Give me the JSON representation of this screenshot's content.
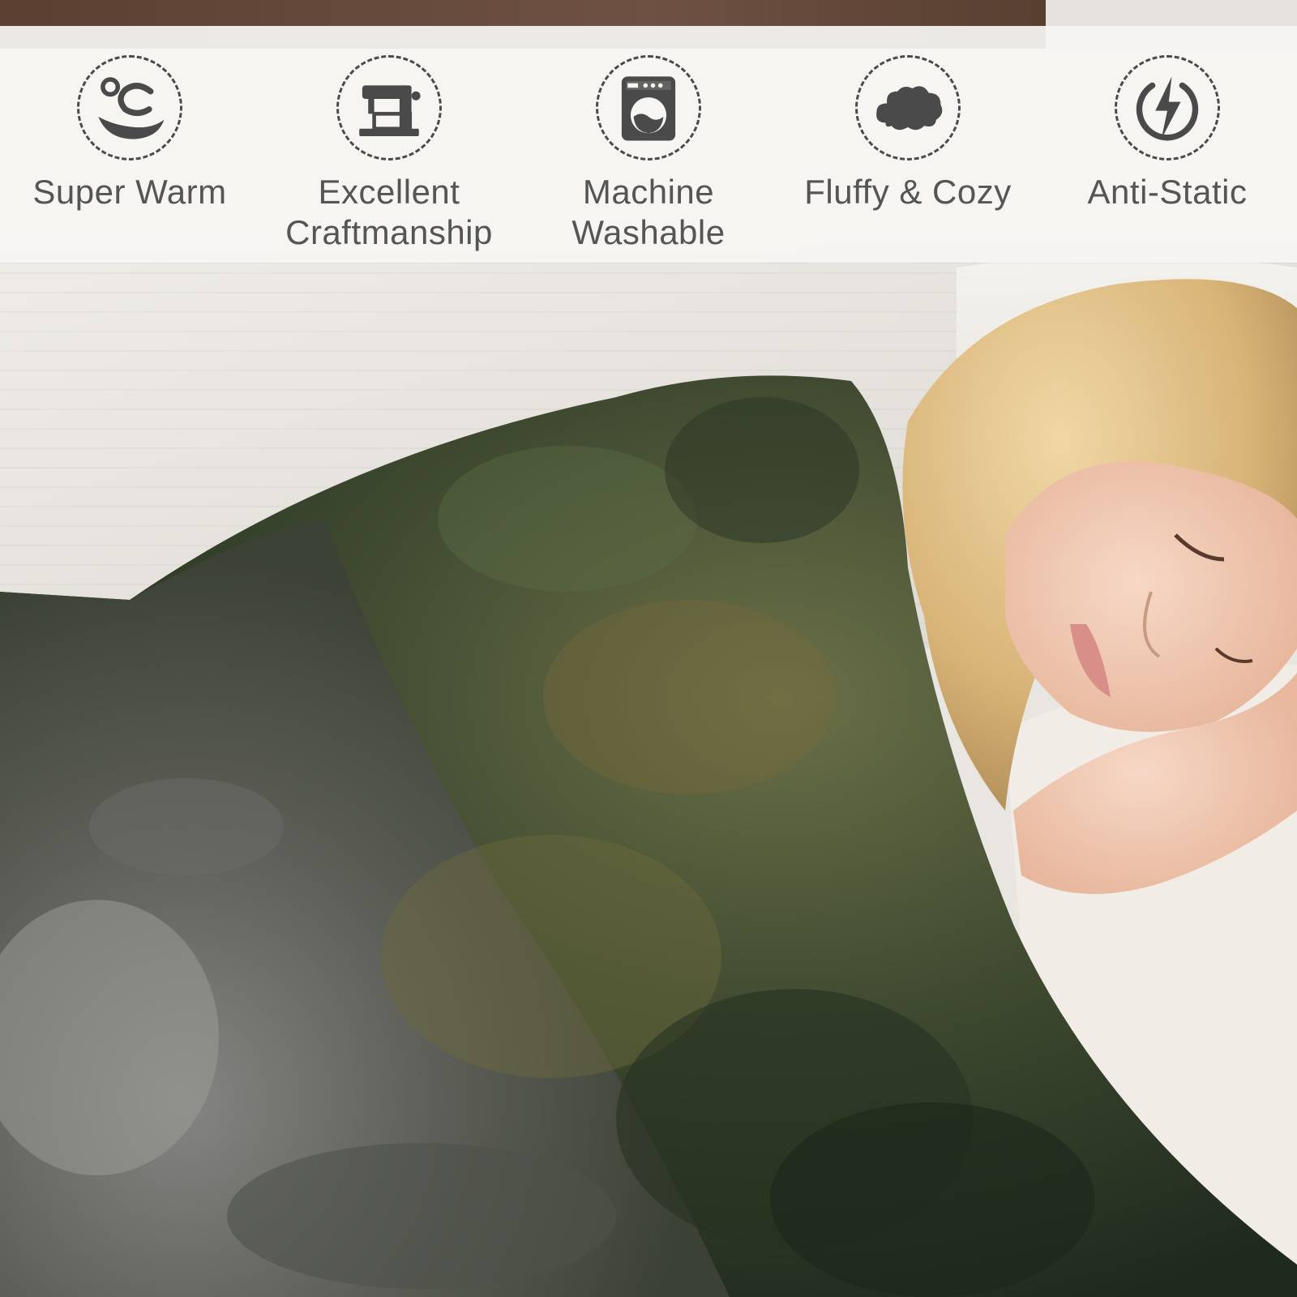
{
  "features": [
    {
      "icon": "warm-temperature-icon",
      "label_lines": [
        "Super Warm"
      ]
    },
    {
      "icon": "sewing-machine-icon",
      "label_lines": [
        "Excellent",
        "Craftmanship"
      ]
    },
    {
      "icon": "washing-machine-icon",
      "label_lines": [
        "Machine",
        "Washable"
      ]
    },
    {
      "icon": "cloud-icon",
      "label_lines": [
        "Fluffy & Cozy"
      ]
    },
    {
      "icon": "lightning-icon",
      "label_lines": [
        "Anti-Static"
      ]
    }
  ],
  "colors": {
    "icon": "#4a4a4a",
    "text": "#555555",
    "bar": "#f6f5f3"
  }
}
